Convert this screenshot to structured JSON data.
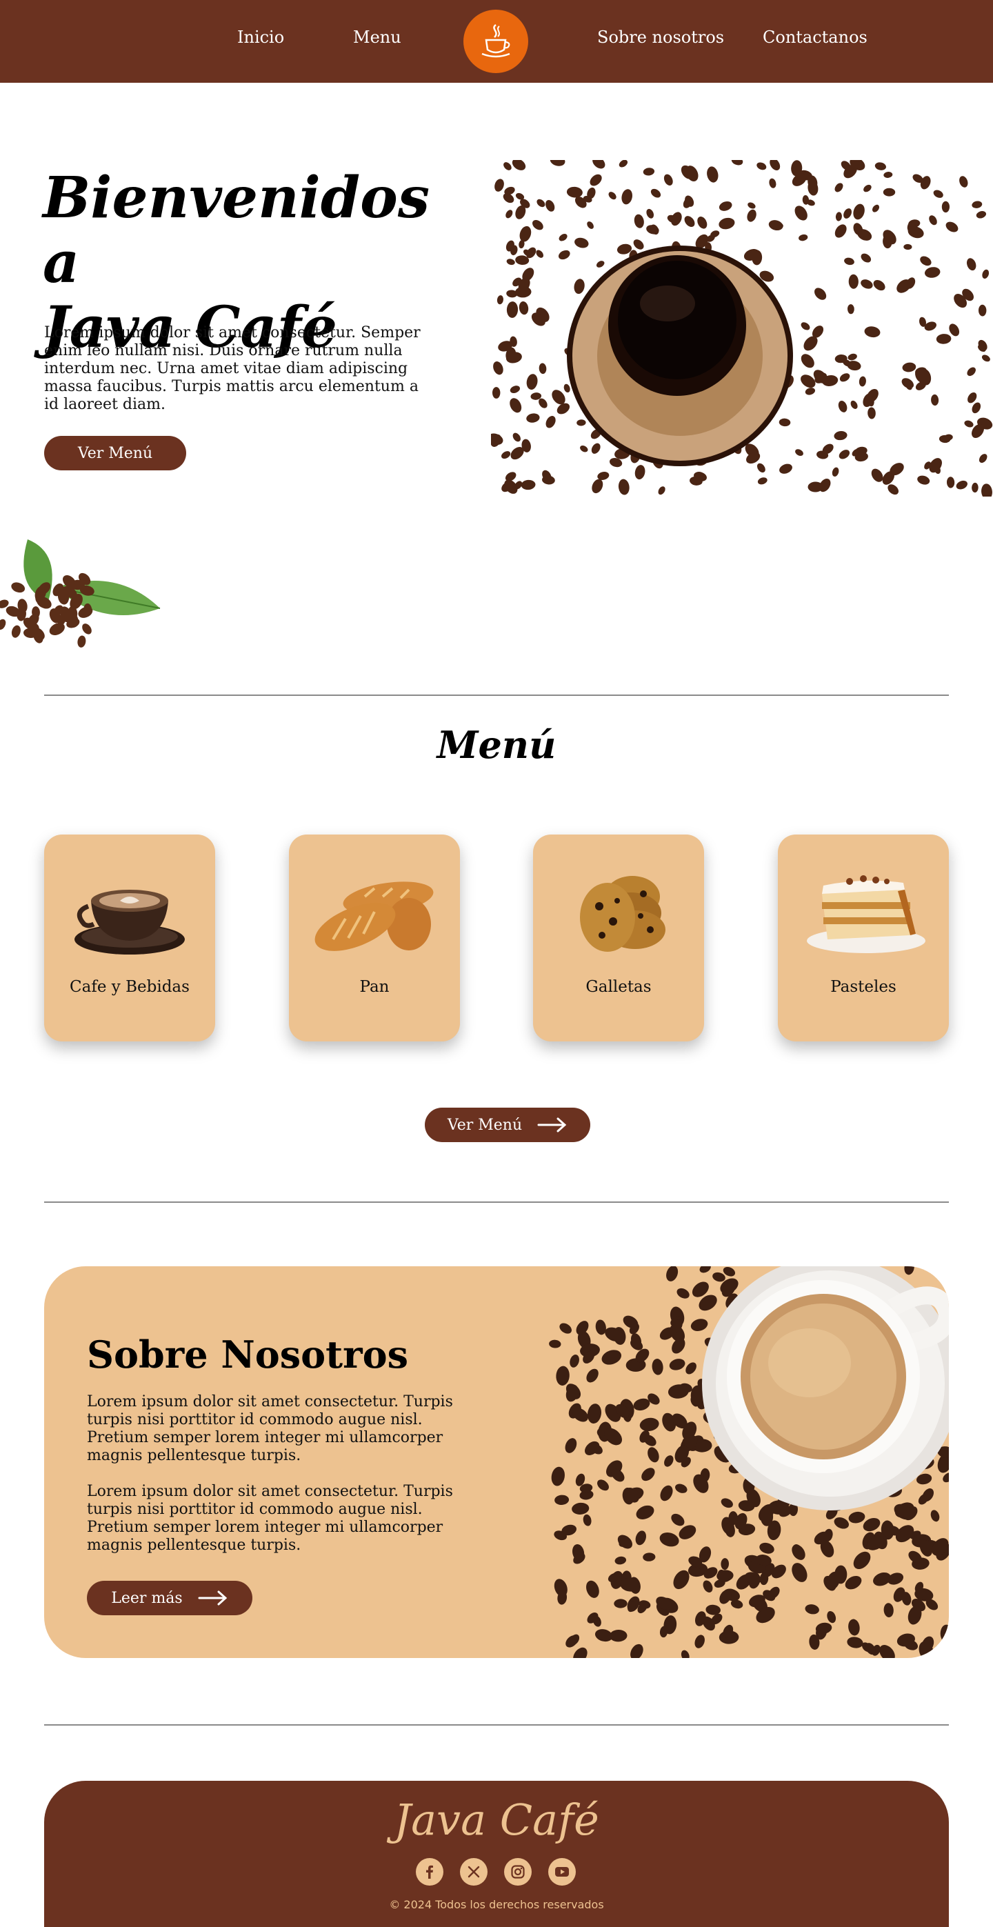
{
  "nav": {
    "links": [
      "Inicio",
      "Menu",
      "Sobre nosotros",
      "Contactanos"
    ],
    "logo_icon": "coffee-cup-icon"
  },
  "hero": {
    "title_line1": "Bienvenidos a",
    "title_line2": "Java Café",
    "text": "Lorem ipsum dolor sit amet consectetur. Semper enim leo nullam nisi. Duis ornare rutrum nulla interdum nec. Urna amet vitae diam adipiscing massa faucibus. Turpis mattis arcu elementum a id laoreet diam.",
    "button": "Ver Menú"
  },
  "menu": {
    "title": "Menú",
    "items": [
      {
        "label": "Cafe y Bebidas",
        "icon": "coffee-cup-image"
      },
      {
        "label": "Pan",
        "icon": "bread-image"
      },
      {
        "label": "Galletas",
        "icon": "cookies-image"
      },
      {
        "label": "Pasteles",
        "icon": "cake-slice-image"
      }
    ],
    "button": "Ver Menú"
  },
  "about": {
    "title": "Sobre Nosotros",
    "p1": "Lorem ipsum dolor sit amet consectetur. Turpis turpis nisi porttitor id commodo augue nisl. Pretium semper lorem integer mi ullamcorper magnis pellentesque turpis.",
    "p2": "Lorem ipsum dolor sit amet consectetur. Turpis turpis nisi porttitor id commodo augue nisl. Pretium semper lorem integer mi ullamcorper magnis pellentesque turpis.",
    "button": "Leer más"
  },
  "footer": {
    "brand": "Java Café",
    "social": [
      "facebook-icon",
      "x-icon",
      "instagram-icon",
      "youtube-icon"
    ],
    "copyright": "© 2024 Todos los derechos reservados"
  },
  "colors": {
    "brown": "#6b3220",
    "tan": "#edc290",
    "orange": "#e8670e"
  }
}
